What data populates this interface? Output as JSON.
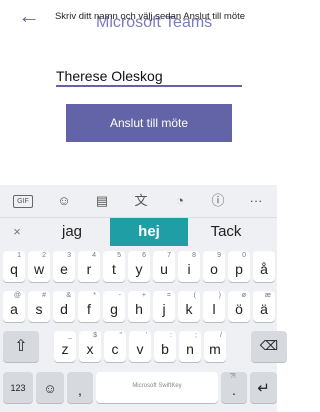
{
  "header": {
    "back_icon": "arrow-left-icon",
    "brand": "Microsoft Teams",
    "hint": "Skriv ditt namn och välj sedan Anslut till möte"
  },
  "form": {
    "name_value": "Therese Oleskog",
    "join_label": "Anslut till möte"
  },
  "keyboard": {
    "toolbar": [
      "GIF",
      "sticker-icon",
      "clipboard-icon",
      "translate-icon",
      "palette-icon",
      "info-icon",
      "more-icon"
    ],
    "toolbar_glyphs": [
      "GIF",
      "☺",
      "▤",
      "文",
      "◔",
      "ⓘ",
      "···"
    ],
    "suggestions": [
      "×",
      "jag",
      "hej",
      "Tack"
    ],
    "row1": [
      {
        "k": "q",
        "s": "1"
      },
      {
        "k": "w",
        "s": "2"
      },
      {
        "k": "e",
        "s": "3"
      },
      {
        "k": "r",
        "s": "4"
      },
      {
        "k": "t",
        "s": "5"
      },
      {
        "k": "y",
        "s": "6"
      },
      {
        "k": "u",
        "s": "7"
      },
      {
        "k": "i",
        "s": "8"
      },
      {
        "k": "o",
        "s": "9"
      },
      {
        "k": "p",
        "s": "0"
      },
      {
        "k": "å",
        "s": ""
      }
    ],
    "row2": [
      {
        "k": "a",
        "s": "@"
      },
      {
        "k": "s",
        "s": "#"
      },
      {
        "k": "d",
        "s": "&"
      },
      {
        "k": "f",
        "s": "*"
      },
      {
        "k": "g",
        "s": "-"
      },
      {
        "k": "h",
        "s": "+"
      },
      {
        "k": "j",
        "s": "="
      },
      {
        "k": "k",
        "s": "("
      },
      {
        "k": "l",
        "s": ")"
      },
      {
        "k": "ö",
        "s": "ø"
      },
      {
        "k": "ä",
        "s": "æ"
      }
    ],
    "row3": [
      {
        "k": "z",
        "s": "_"
      },
      {
        "k": "x",
        "s": "$"
      },
      {
        "k": "c",
        "s": "\""
      },
      {
        "k": "v",
        "s": "'"
      },
      {
        "k": "b",
        "s": ":"
      },
      {
        "k": "n",
        "s": ";"
      },
      {
        "k": "m",
        "s": "/"
      }
    ],
    "shift_icon": "shift-icon",
    "backspace_icon": "backspace-icon",
    "num_label": "123",
    "emoji_icon": "emoji-icon",
    "comma_label": ",",
    "space_label": "Microsoft SwiftKey",
    "period_label": ".",
    "enter_icon": "enter-icon"
  }
}
